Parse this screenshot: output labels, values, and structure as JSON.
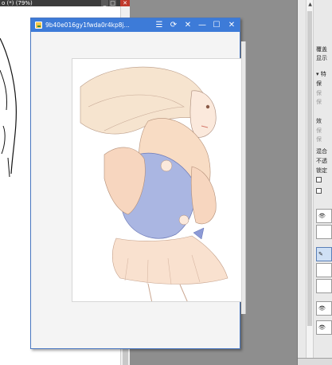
{
  "background_window": {
    "title": "o (*) (79%)",
    "min_label": "_",
    "max_label": "□",
    "close_label": "✕"
  },
  "viewer": {
    "title": "9b40e016gy1fwda0r4kp8j...",
    "controls": {
      "menu": "☰",
      "restore": "⟳",
      "close_alt": "✕",
      "minimize": "—",
      "maximize": "☐",
      "close": "✕"
    }
  },
  "right_panel": {
    "scroll_up": "▲",
    "rows": [
      {
        "text": "覆盖",
        "dim": false
      },
      {
        "text": "显示",
        "dim": false
      },
      {
        "text": "▾ 特",
        "dim": false
      },
      {
        "text": "保",
        "dim": false
      },
      {
        "text": "保",
        "dim": true
      },
      {
        "text": "保",
        "dim": true
      },
      {
        "text": "效",
        "dim": false
      },
      {
        "text": "保",
        "dim": true
      },
      {
        "text": "保",
        "dim": true
      },
      {
        "text": "混合",
        "dim": false
      },
      {
        "text": "不透",
        "dim": false
      },
      {
        "text": "锁定",
        "dim": false
      }
    ],
    "eye_icon": "👁",
    "pen_icon": "✎"
  },
  "colors": {
    "viewer_titlebar": "#3d7bd8",
    "workspace": "#8e8e8e",
    "panel": "#e9e9e9"
  }
}
